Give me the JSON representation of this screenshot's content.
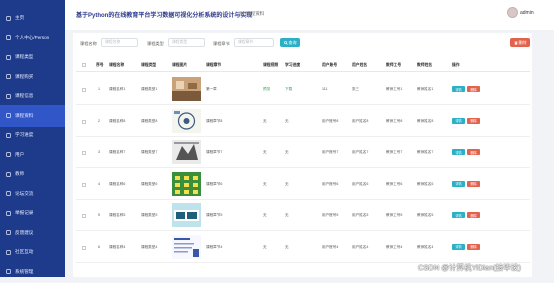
{
  "sidebar": {
    "items": [
      {
        "label": "主页",
        "icon": "home-icon",
        "active": false
      },
      {
        "label": "个人中心/Person",
        "icon": "user-icon",
        "active": false
      },
      {
        "label": "课程类型",
        "icon": "list-icon",
        "active": false
      },
      {
        "label": "课程购买",
        "icon": "cart-icon",
        "active": false
      },
      {
        "label": "课程信息",
        "icon": "doc-icon",
        "active": false
      },
      {
        "label": "课程资料",
        "icon": "folder-icon",
        "active": true
      },
      {
        "label": "学习进度",
        "icon": "progress-icon",
        "active": false
      },
      {
        "label": "用户",
        "icon": "users-icon",
        "active": false
      },
      {
        "label": "教师",
        "icon": "teacher-icon",
        "active": false
      },
      {
        "label": "论坛交流",
        "icon": "chat-icon",
        "active": false
      },
      {
        "label": "举报记录",
        "icon": "flag-icon",
        "active": false
      },
      {
        "label": "反馈建议",
        "icon": "feedback-icon",
        "active": false
      },
      {
        "label": "社区互动",
        "icon": "community-icon",
        "active": false
      },
      {
        "label": "系统管理",
        "icon": "settings-icon",
        "active": false
      }
    ]
  },
  "header": {
    "title": "基于Python的在线教育平台学习数据可视化分析系统的设计与实现",
    "breadcrumb_sep": "课程",
    "breadcrumb": "课程资料",
    "username": "admin"
  },
  "search": {
    "fields": [
      {
        "label": "课程名称",
        "placeholder": "课程名称"
      },
      {
        "label": "课程类型",
        "placeholder": "课程类型"
      },
      {
        "label": "课程章节",
        "placeholder": "课程章节"
      }
    ],
    "search_label": "查询",
    "delete_label": "删除"
  },
  "table": {
    "headers": [
      "序号",
      "课程名称",
      "课程类型",
      "课程图片",
      "课程章节",
      "课程视频",
      "学习进度",
      "用户账号",
      "用户姓名",
      "教师工号",
      "教师姓名",
      "操作"
    ],
    "rows": [
      {
        "no": "1",
        "name": "课程名称1",
        "type": "课程类型1",
        "chapter": "第一章",
        "video": "预览",
        "progress": "下载",
        "account": "111",
        "uname": "张三",
        "tno": "教师工号1",
        "tname": "教师姓名1"
      },
      {
        "no": "2",
        "name": "课程名称8",
        "type": "课程类型8",
        "chapter": "课程章节8",
        "video": "无",
        "progress": "无",
        "account": "用户账号8",
        "uname": "用户姓名8",
        "tno": "教师工号8",
        "tname": "教师姓名8"
      },
      {
        "no": "3",
        "name": "课程名称7",
        "type": "课程类型7",
        "chapter": "课程章节7",
        "video": "无",
        "progress": "无",
        "account": "用户账号7",
        "uname": "用户姓名7",
        "tno": "教师工号7",
        "tname": "教师姓名7"
      },
      {
        "no": "4",
        "name": "课程名称6",
        "type": "课程类型6",
        "chapter": "课程章节6",
        "video": "无",
        "progress": "无",
        "account": "用户账号6",
        "uname": "用户姓名6",
        "tno": "教师工号6",
        "tname": "教师姓名6"
      },
      {
        "no": "5",
        "name": "课程名称5",
        "type": "课程类型5",
        "chapter": "课程章节5",
        "video": "无",
        "progress": "无",
        "account": "用户账号5",
        "uname": "用户姓名5",
        "tno": "教师工号5",
        "tname": "教师姓名5"
      },
      {
        "no": "6",
        "name": "课程名称4",
        "type": "课程类型4",
        "chapter": "课程章节4",
        "video": "无",
        "progress": "无",
        "account": "用户账号4",
        "uname": "用户姓名4",
        "tno": "教师工号4",
        "tname": "教师姓名4"
      }
    ],
    "detail_label": "详情",
    "row_delete_label": "删除"
  },
  "watermark": "CSDN @计算机YiDian(接毕设)",
  "colors": {
    "sidebar": "#1e3a8a",
    "active": "#3056c8",
    "accent": "#2bb0c7",
    "danger": "#e2624c",
    "link_green": "#2e9d4e"
  }
}
